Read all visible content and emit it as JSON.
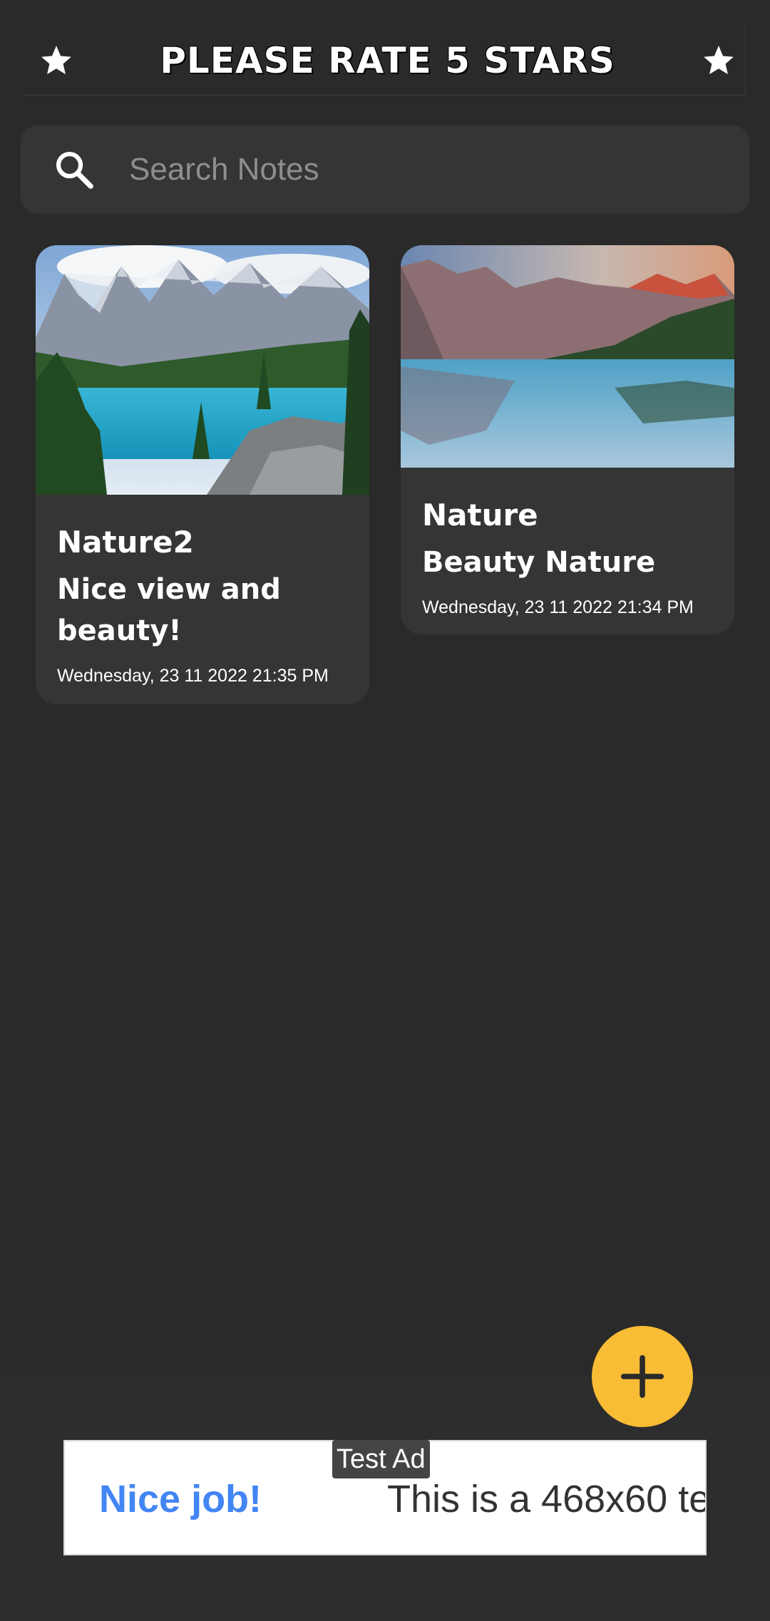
{
  "banner": {
    "title": "PLEASE RATE 5 STARS"
  },
  "search": {
    "placeholder": "Search Notes",
    "value": ""
  },
  "notes": [
    {
      "title": "Nature2",
      "text": "Nice view and beauty!",
      "date": "Wednesday, 23 11 2022 21:35 PM"
    },
    {
      "title": "Nature",
      "text": "Beauty Nature",
      "date": "Wednesday, 23 11 2022 21:34 PM"
    }
  ],
  "fab": {
    "icon": "plus-icon"
  },
  "ad": {
    "tag": "Test Ad",
    "headline": "Nice job!",
    "body": "This is a 468x60 te"
  },
  "colors": {
    "background": "#2a2a2a",
    "card": "#353535",
    "fab": "#f8bd35",
    "ad_headline": "#4285f4"
  }
}
